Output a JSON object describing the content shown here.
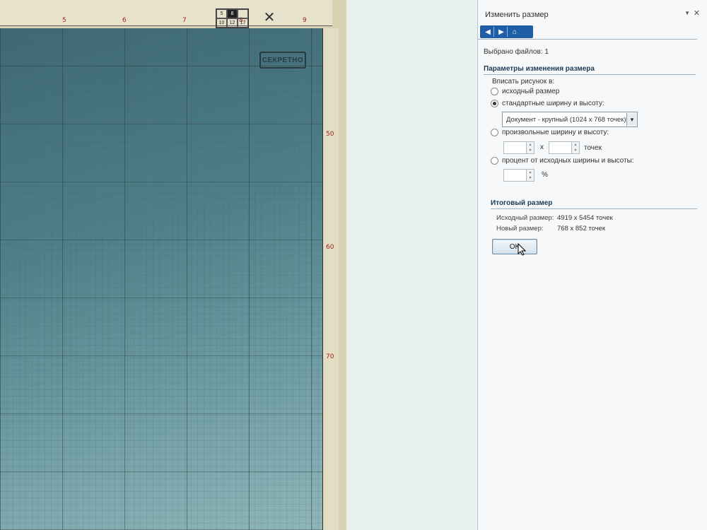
{
  "panel": {
    "title": "Изменить размер",
    "files_selected": "Выбрано файлов: 1",
    "params_header": "Параметры изменения размера",
    "fit_label": "Вписать рисунок в:",
    "options": {
      "original": "исходный размер",
      "standard": "стандартные ширину и высоту:",
      "custom": "произвольные ширину и высоту:",
      "percent": "процент от исходных ширины и высоты:"
    },
    "selected_option": "standard",
    "standard_select_value": "Документ - крупный (1024 x 768 точек)",
    "custom_separator": "x",
    "custom_unit": "точек",
    "percent_unit": "%",
    "result_header": "Итоговый размер",
    "original_size_label": "Исходный размер:",
    "original_size_value": "4919 x 5454 точек",
    "new_size_label": "Новый размер:",
    "new_size_value": "768 x 852 точек",
    "ok_label": "OK"
  },
  "map": {
    "stamp": "СЕКРЕТНО",
    "top_scale": [
      "5",
      "6",
      "7",
      "8",
      "9"
    ],
    "side_scale": [
      "50",
      "60",
      "70"
    ],
    "legend": [
      "5",
      "8",
      "",
      "10",
      "12",
      "17"
    ]
  },
  "colors": {
    "nav_bar": "#1e5fa8",
    "header_text": "#1c3a55"
  }
}
